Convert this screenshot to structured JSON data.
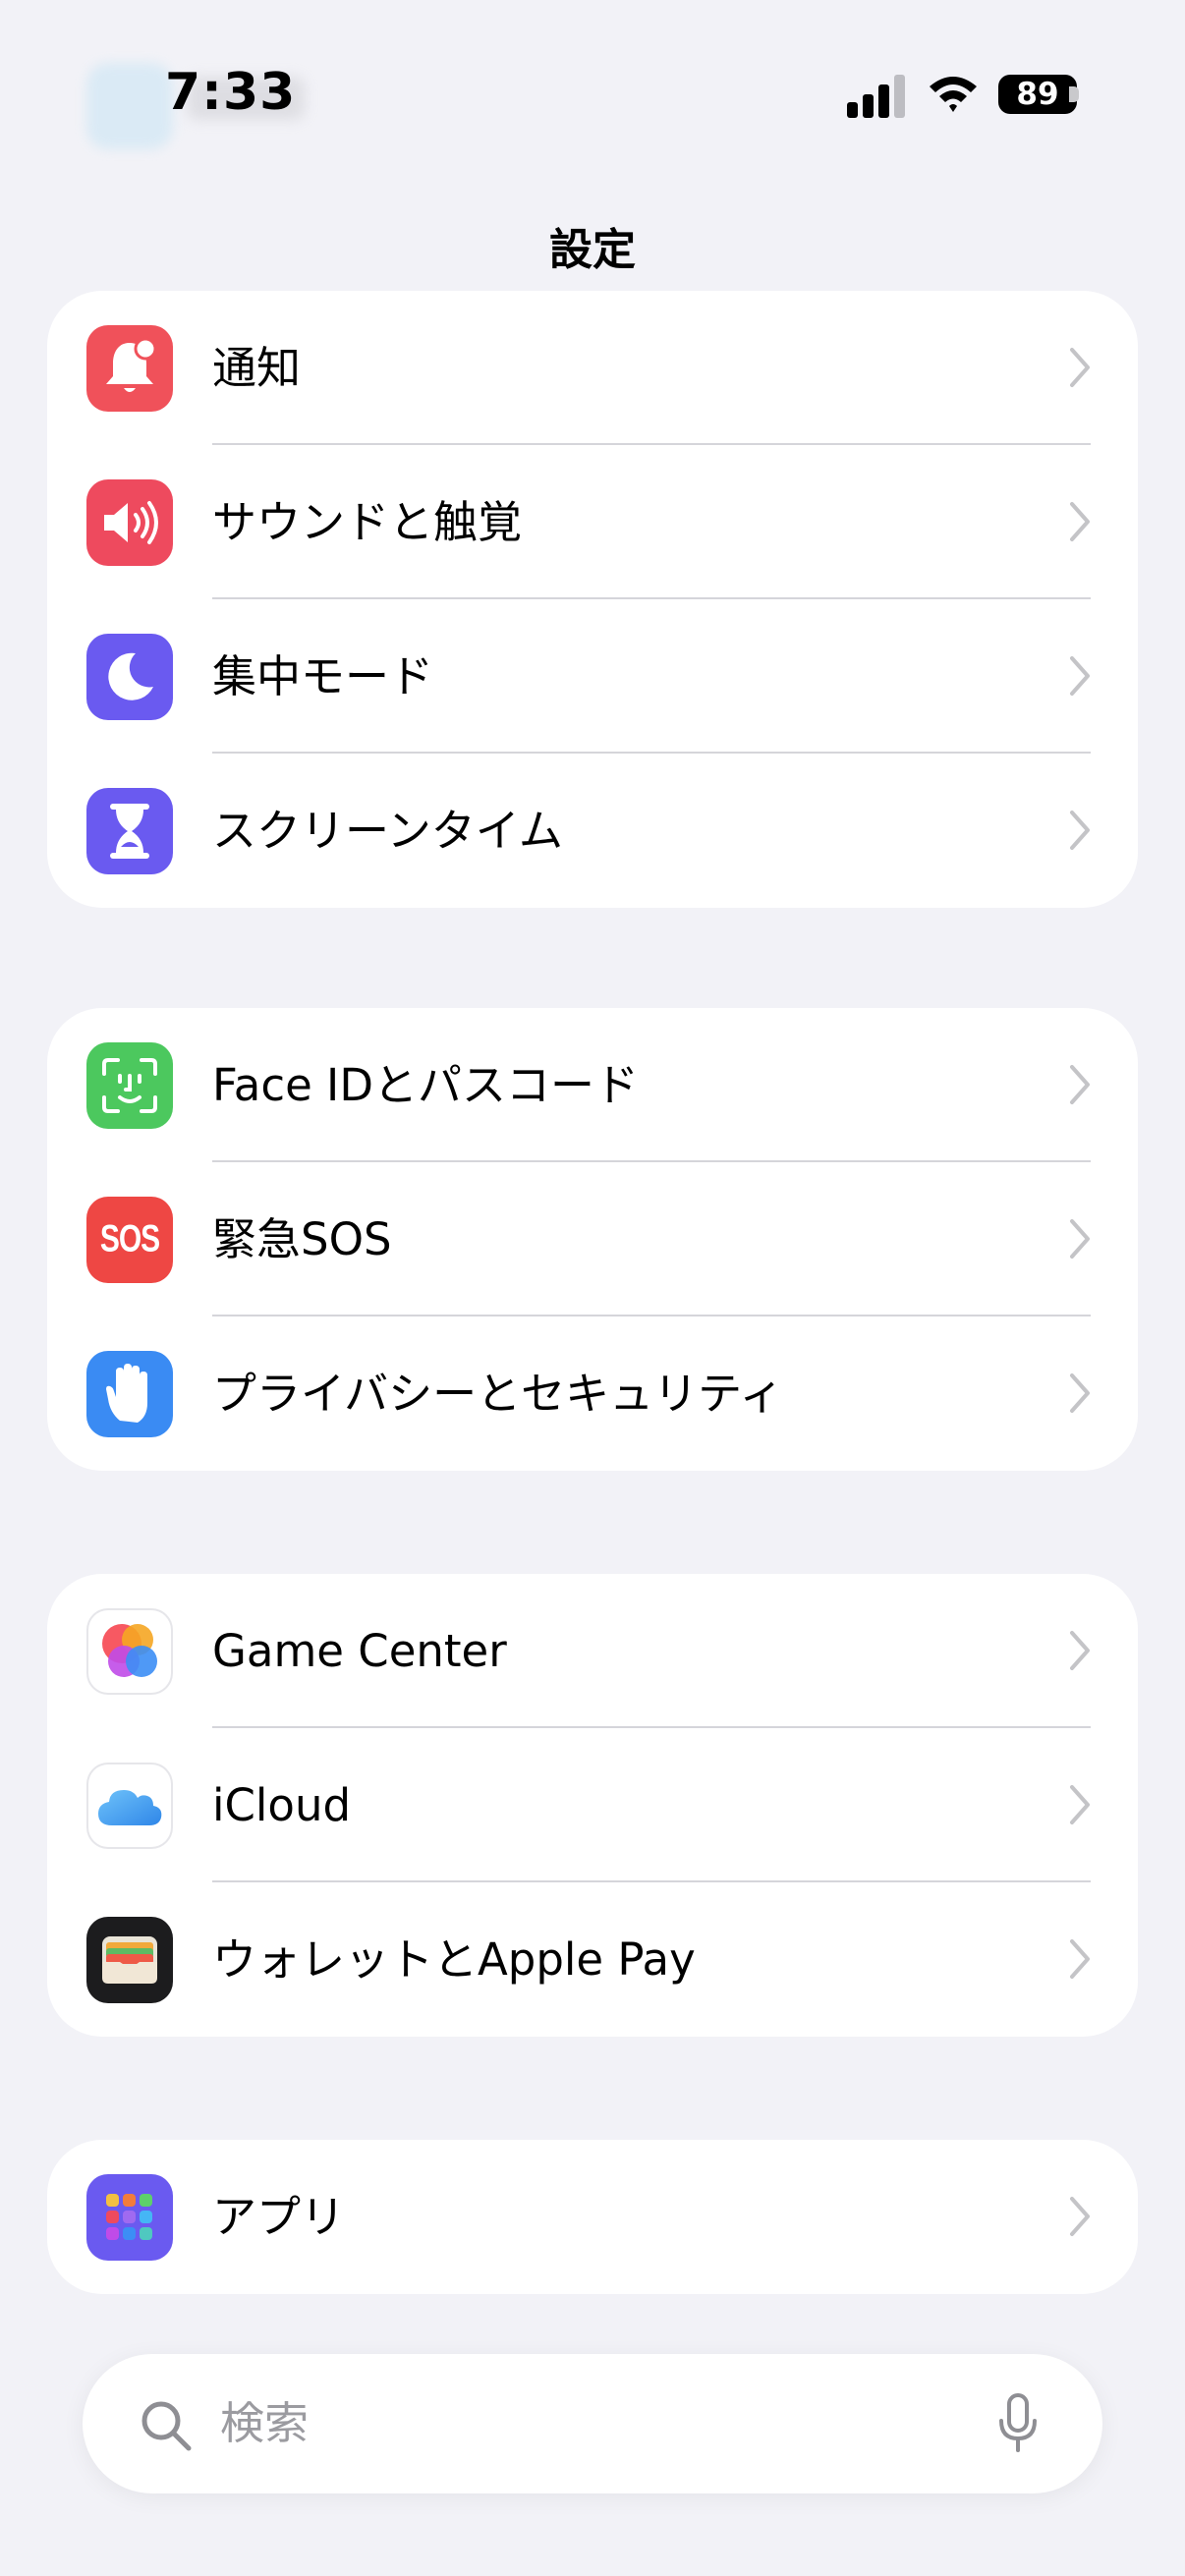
{
  "status_bar": {
    "time": "7:33",
    "battery": "89"
  },
  "header": {
    "title": "設定"
  },
  "groups": [
    {
      "items": [
        {
          "label": "通知",
          "icon": "bell-badge-icon",
          "color": "#F0515A"
        },
        {
          "label": "サウンドと触覚",
          "icon": "speaker-wave-icon",
          "color": "#EE4A5E"
        },
        {
          "label": "集中モード",
          "icon": "moon-icon",
          "color": "#6A5AF0"
        },
        {
          "label": "スクリーンタイム",
          "icon": "hourglass-icon",
          "color": "#6A5AF0"
        }
      ]
    },
    {
      "items": [
        {
          "label": "Face IDとパスコード",
          "icon": "face-id-icon",
          "color": "#4CC85E"
        },
        {
          "label": "緊急SOS",
          "icon": "sos-icon",
          "color": "#EE4744",
          "icon_text": "SOS"
        },
        {
          "label": "プライバシーとセキュリティ",
          "icon": "hand-icon",
          "color": "#3A8BF3"
        }
      ]
    },
    {
      "items": [
        {
          "label": "Game Center",
          "icon": "game-center-icon",
          "color": "#FFFFFF"
        },
        {
          "label": "iCloud",
          "icon": "cloud-icon",
          "color": "#FFFFFF"
        },
        {
          "label": "ウォレットとApple Pay",
          "icon": "wallet-icon",
          "color": "#1C1C1E"
        }
      ]
    },
    {
      "items": [
        {
          "label": "アプリ",
          "icon": "app-grid-icon",
          "color": "#6A5AF0"
        }
      ]
    }
  ],
  "search": {
    "placeholder": "検索"
  }
}
